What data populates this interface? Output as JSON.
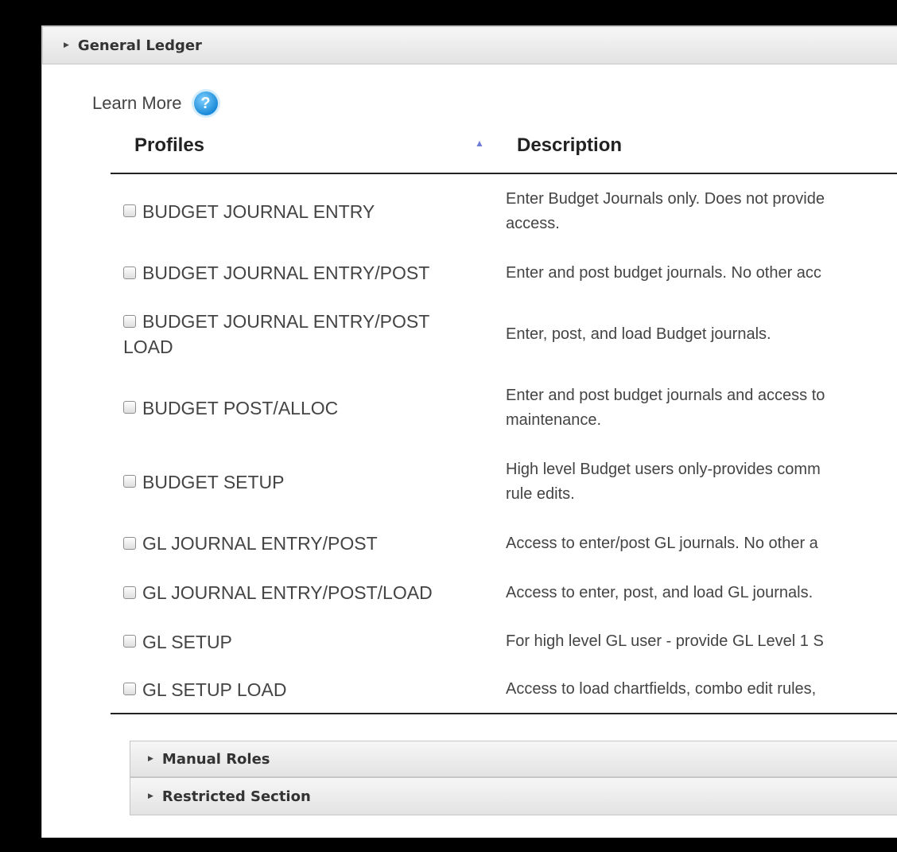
{
  "section": {
    "title": "General Ledger",
    "expand_icon": "caret-right-icon"
  },
  "learn_more": {
    "label": "Learn More",
    "icon_glyph": "?",
    "icon": "help-circle-icon",
    "icon_color": "#1a8ad8"
  },
  "table": {
    "columns": {
      "profiles": "Profiles",
      "description": "Description"
    },
    "sort": {
      "column": "profiles",
      "direction": "ascending",
      "icon": "sort-up-triangle-icon",
      "glyph": "▲",
      "color": "#6f7cd6"
    },
    "rows": [
      {
        "profile": "BUDGET JOURNAL ENTRY",
        "checked": false,
        "description_lines": [
          "Enter Budget Journals only. Does not provide",
          "access."
        ]
      },
      {
        "profile": "BUDGET JOURNAL ENTRY/POST",
        "checked": false,
        "description_lines": [
          "Enter and post budget journals. No other acc"
        ]
      },
      {
        "profile": "BUDGET JOURNAL ENTRY/POST LOAD",
        "checked": false,
        "description_lines": [
          "Enter, post, and load Budget journals."
        ]
      },
      {
        "profile": "BUDGET POST/ALLOC",
        "checked": false,
        "description_lines": [
          "Enter and post budget journals and access to",
          "maintenance."
        ]
      },
      {
        "profile": "BUDGET SETUP",
        "checked": false,
        "description_lines": [
          "High level Budget users only-provides comm",
          "rule edits."
        ]
      },
      {
        "profile": "GL JOURNAL ENTRY/POST",
        "checked": false,
        "description_lines": [
          "Access to enter/post GL journals. No other a"
        ]
      },
      {
        "profile": "GL JOURNAL ENTRY/POST/LOAD",
        "checked": false,
        "description_lines": [
          "Access to enter, post, and load GL journals."
        ]
      },
      {
        "profile": "GL SETUP",
        "checked": false,
        "description_lines": [
          "For high level GL user - provide GL Level 1 S"
        ]
      },
      {
        "profile": "GL SETUP LOAD",
        "checked": false,
        "description_lines": [
          "Access to load chartfields, combo edit rules,"
        ]
      }
    ]
  },
  "subsections": [
    {
      "title": "Manual Roles",
      "icon": "caret-right-icon"
    },
    {
      "title": "Restricted Section",
      "icon": "caret-right-icon"
    }
  ]
}
